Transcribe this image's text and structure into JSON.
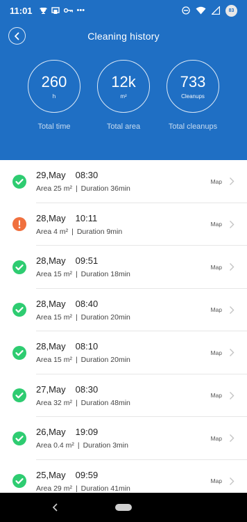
{
  "status_bar": {
    "time": "11:01",
    "battery": "83",
    "dots": "•••",
    "icons_left": [
      "trophy-icon",
      "cast-icon",
      "key-icon"
    ],
    "icons_right": [
      "dnd-icon",
      "wifi-icon",
      "signal-icon",
      "battery-icon"
    ]
  },
  "header": {
    "title": "Cleaning history",
    "background_color": "#1f6fc4"
  },
  "stats": [
    {
      "value": "260",
      "unit": "h",
      "label": "Total time"
    },
    {
      "value": "12k",
      "unit": "m²",
      "label": "Total area"
    },
    {
      "value": "733",
      "unit": "Cleanups",
      "label": "Total cleanups"
    }
  ],
  "history": [
    {
      "date": "29,May",
      "time": "08:30",
      "area": "Area 25 m²",
      "duration": "Duration 36min",
      "status": "complete",
      "map_label": "Map"
    },
    {
      "date": "28,May",
      "time": "10:11",
      "area": "Area 4 m²",
      "duration": "Duration 9min",
      "status": "warning",
      "map_label": "Map"
    },
    {
      "date": "28,May",
      "time": "09:51",
      "area": "Area 15 m²",
      "duration": "Duration 18min",
      "status": "complete",
      "map_label": "Map"
    },
    {
      "date": "28,May",
      "time": "08:40",
      "area": "Area 15 m²",
      "duration": "Duration 20min",
      "status": "complete",
      "map_label": "Map"
    },
    {
      "date": "28,May",
      "time": "08:10",
      "area": "Area 15 m²",
      "duration": "Duration 20min",
      "status": "complete",
      "map_label": "Map"
    },
    {
      "date": "27,May",
      "time": "08:30",
      "area": "Area 32 m²",
      "duration": "Duration 48min",
      "status": "complete",
      "map_label": "Map"
    },
    {
      "date": "26,May",
      "time": "19:09",
      "area": "Area 0.4 m²",
      "duration": "Duration 3min",
      "status": "complete",
      "map_label": "Map"
    },
    {
      "date": "25,May",
      "time": "09:59",
      "area": "Area 29 m²",
      "duration": "Duration 41min",
      "status": "complete",
      "map_label": "Map"
    }
  ],
  "colors": {
    "complete": "#2ecc71",
    "warning": "#f0703e"
  },
  "separator": "|"
}
